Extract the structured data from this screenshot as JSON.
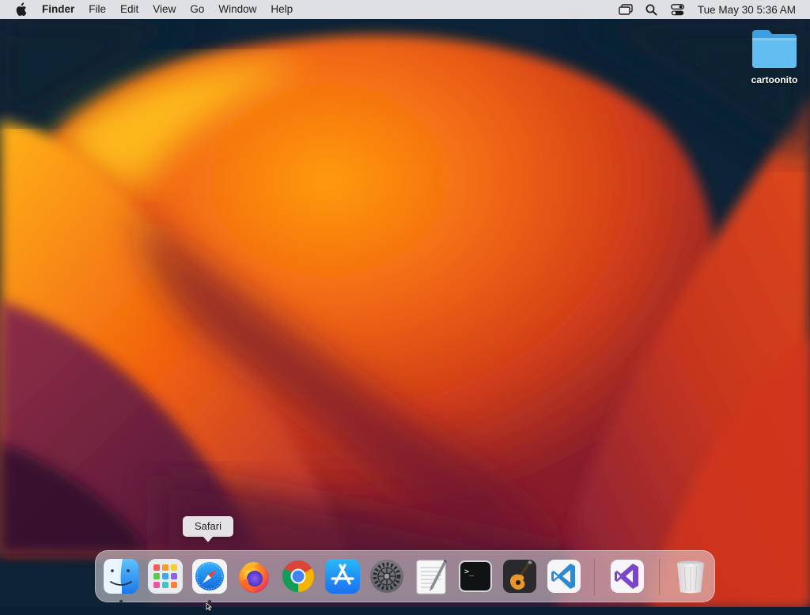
{
  "menubar": {
    "apple_icon": "apple-logo-icon",
    "app_name": "Finder",
    "menus": [
      "File",
      "Edit",
      "View",
      "Go",
      "Window",
      "Help"
    ],
    "status_icons": [
      "screen-mirroring-icon",
      "spotlight-search-icon",
      "control-center-icon"
    ],
    "clock": "Tue May 30  5:36 AM"
  },
  "desktop": {
    "folder_label": "cartoonito",
    "folder_icon": "folder-icon"
  },
  "tooltip": {
    "label": "Safari"
  },
  "dock": {
    "apps": [
      {
        "name": "finder",
        "icon": "finder-icon",
        "running": true
      },
      {
        "name": "launchpad",
        "icon": "launchpad-icon",
        "running": false
      },
      {
        "name": "safari",
        "icon": "safari-icon",
        "running": true
      },
      {
        "name": "firefox",
        "icon": "firefox-icon",
        "running": false
      },
      {
        "name": "chrome",
        "icon": "chrome-icon",
        "running": false
      },
      {
        "name": "app-store",
        "icon": "app-store-icon",
        "running": false
      },
      {
        "name": "system-settings",
        "icon": "gear-icon",
        "running": false
      },
      {
        "name": "textedit",
        "icon": "textedit-icon",
        "running": false
      },
      {
        "name": "terminal",
        "icon": "terminal-icon",
        "running": false
      },
      {
        "name": "garageband",
        "icon": "guitar-icon",
        "running": false
      },
      {
        "name": "vscode",
        "icon": "vscode-icon",
        "running": false
      },
      {
        "name": "visual-studio",
        "icon": "visual-studio-icon",
        "running": false
      },
      {
        "name": "trash",
        "icon": "trash-icon",
        "running": false
      }
    ],
    "terminal_prompt": ">_"
  },
  "colors": {
    "finder_blue": "#1e90ff",
    "folder_blue": "#5ab4ec",
    "vscode_blue": "#2a8ad4",
    "vs_purple": "#7a46c8"
  }
}
